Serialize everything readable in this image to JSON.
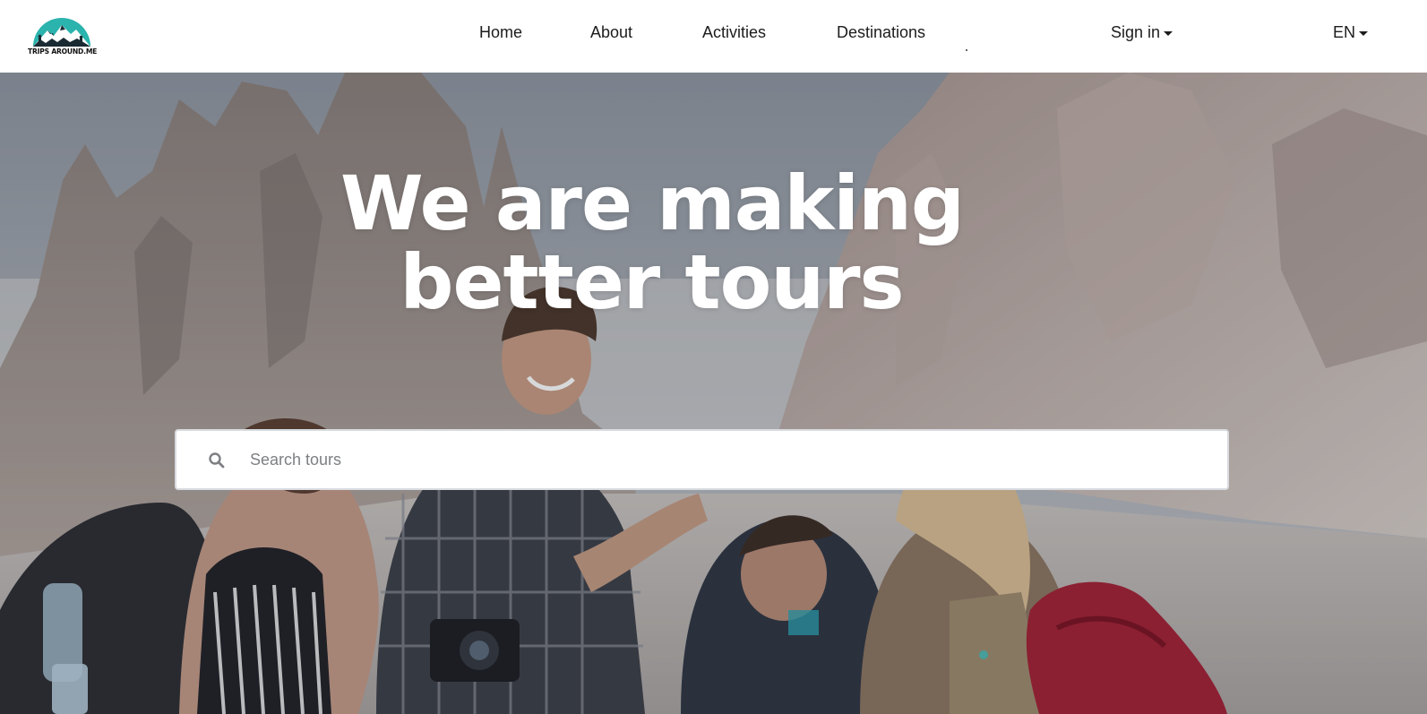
{
  "brand": {
    "logo_text": "TRIPS AROUND.ME",
    "accent": "#2bb3ad"
  },
  "nav": {
    "links": [
      {
        "label": "Home"
      },
      {
        "label": "About"
      },
      {
        "label": "Activities"
      },
      {
        "label": "Destinations"
      }
    ],
    "sign_in": {
      "label": "Sign in",
      "icon": "caret-down-icon"
    },
    "language": {
      "label": "EN",
      "icon": "caret-down-icon"
    }
  },
  "hero": {
    "headline_line1": "We are making",
    "headline_line2": "better tours",
    "search": {
      "placeholder": "Search tours",
      "value": "",
      "icon": "search-icon"
    }
  }
}
